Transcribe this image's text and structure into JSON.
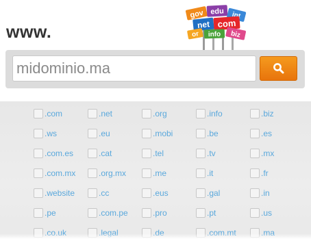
{
  "header": {
    "prefix": "www.",
    "sign_words": [
      "gov",
      "edu",
      "int",
      "net",
      "com",
      "or",
      "info",
      "biz"
    ]
  },
  "search": {
    "placeholder": "midominio.ma",
    "value": "",
    "button_icon": "search-icon",
    "button_color": "#ee7f10"
  },
  "tlds": [
    [
      ".com",
      ".net",
      ".org",
      ".info",
      ".biz"
    ],
    [
      ".ws",
      ".eu",
      ".mobi",
      ".be",
      ".es"
    ],
    [
      ".com.es",
      ".cat",
      ".tel",
      ".tv",
      ".mx"
    ],
    [
      ".com.mx",
      ".org.mx",
      ".me",
      ".it",
      ".fr"
    ],
    [
      ".website",
      ".cc",
      ".eus",
      ".gal",
      ".in"
    ],
    [
      ".pe",
      ".com.pe",
      ".pro",
      ".pt",
      ".us"
    ],
    [
      ".co.uk",
      ".legal",
      ".de",
      ".com.mt",
      ".ma"
    ]
  ],
  "colors": {
    "link": "#5aa8dc",
    "bar_bg": "#dcdcdc",
    "area_bg": "#ebebeb"
  }
}
